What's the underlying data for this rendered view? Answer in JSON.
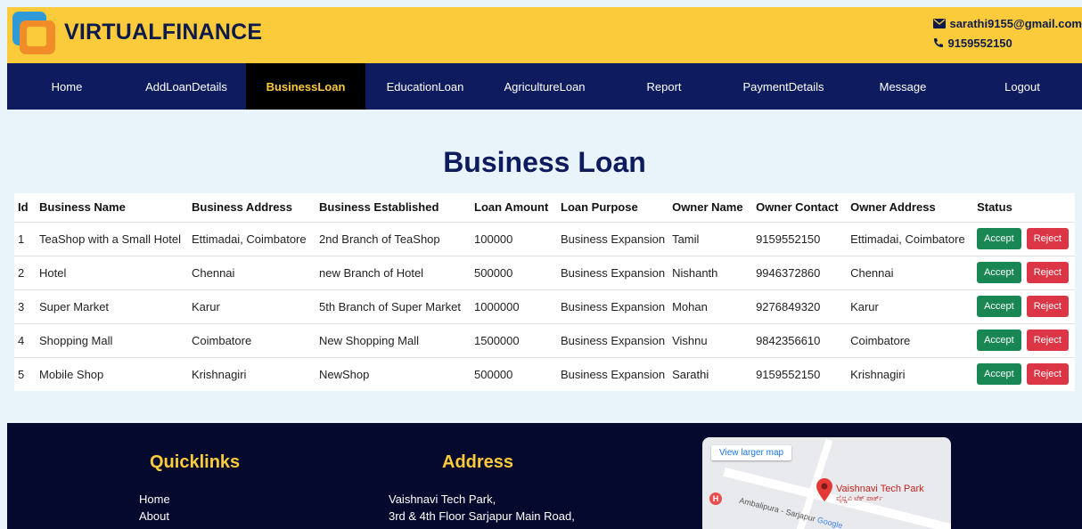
{
  "header": {
    "brand": "VIRTUALFINANCE",
    "email": "sarathi9155@gmail.com",
    "phone": "9159552150"
  },
  "nav": {
    "items": [
      {
        "label": "Home"
      },
      {
        "label": "AddLoanDetails"
      },
      {
        "label": "BusinessLoan"
      },
      {
        "label": "EducationLoan"
      },
      {
        "label": "AgricultureLoan"
      },
      {
        "label": "Report"
      },
      {
        "label": "PaymentDetails"
      },
      {
        "label": "Message"
      },
      {
        "label": "Logout"
      }
    ],
    "active": "BusinessLoan"
  },
  "page": {
    "title": "Business Loan"
  },
  "table": {
    "headers": [
      "Id",
      "Business Name",
      "Business Address",
      "Business Established",
      "Loan Amount",
      "Loan Purpose",
      "Owner Name",
      "Owner Contact",
      "Owner Address",
      "Status"
    ],
    "accept_label": "Accept",
    "reject_label": "Reject",
    "rows": [
      [
        "1",
        "TeaShop with a Small Hotel",
        "Ettimadai, Coimbatore",
        "2nd Branch of TeaShop",
        "100000",
        "Business Expansion",
        "Tamil",
        "9159552150",
        "Ettimadai, Coimbatore"
      ],
      [
        "2",
        "Hotel",
        "Chennai",
        "new Branch of Hotel",
        "500000",
        "Business Expansion",
        "Nishanth",
        "9946372860",
        "Chennai"
      ],
      [
        "3",
        "Super Market",
        "Karur",
        "5th Branch of Super Market",
        "1000000",
        "Business Expansion",
        "Mohan",
        "9276849320",
        "Karur"
      ],
      [
        "4",
        "Shopping Mall",
        "Coimbatore",
        "New Shopping Mall",
        "1500000",
        "Business Expansion",
        "Vishnu",
        "9842356610",
        "Coimbatore"
      ],
      [
        "5",
        "Mobile Shop",
        "Krishnagiri",
        "NewShop",
        "500000",
        "Business Expansion",
        "Sarathi",
        "9159552150",
        "Krishnagiri"
      ]
    ]
  },
  "footer": {
    "quicklinks_title": "Quicklinks",
    "quicklinks": [
      "Home",
      "About"
    ],
    "address_title": "Address",
    "address_lines": [
      "Vaishnavi Tech Park,",
      "3rd & 4th Floor Sarjapur Main Road,"
    ],
    "map": {
      "view_larger": "View larger map",
      "place_name": "Vaishnavi Tech Park",
      "place_sub": "ವೈಷ್ಣವಿ ಟೆಕ್ ಪಾರ್ಕ್",
      "road_label": "Ambalipura - Sarjapur",
      "provider": "Google"
    }
  },
  "colors": {
    "header_bg": "#fccb3b",
    "nav_bg": "#0e1b5f",
    "footer_bg": "#05092e",
    "accept": "#198754",
    "reject": "#dc3545"
  }
}
